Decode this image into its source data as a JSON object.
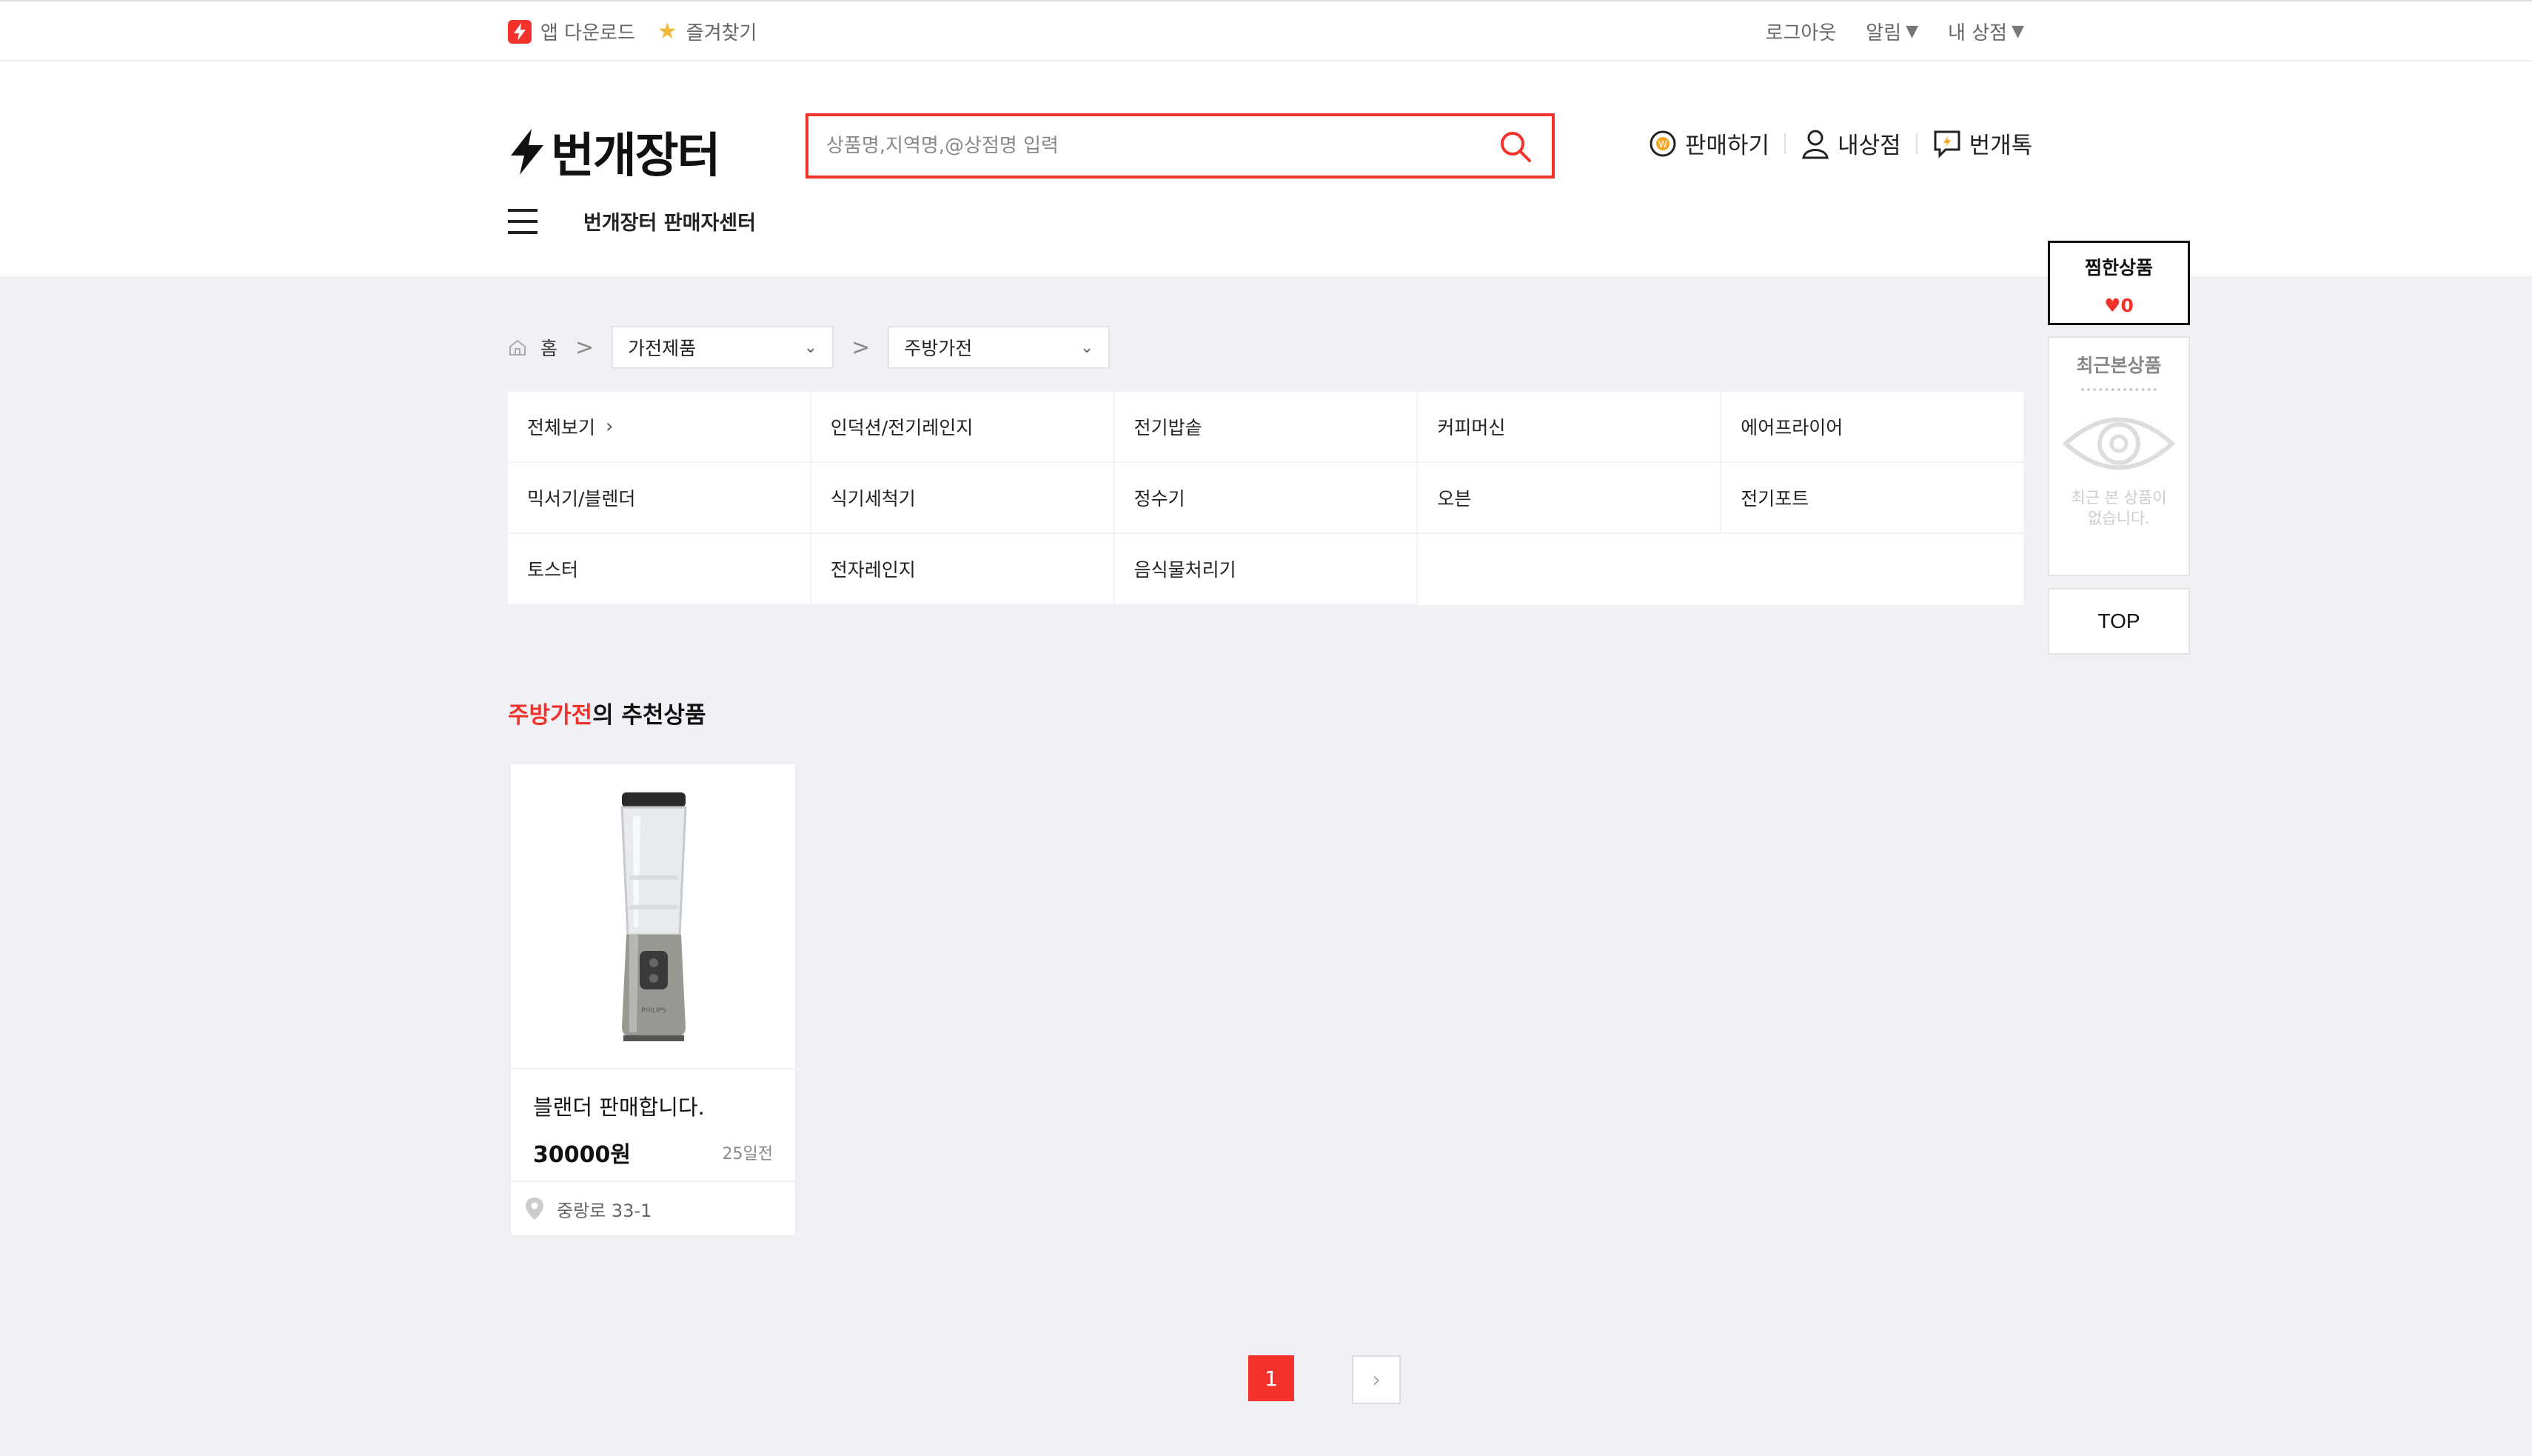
{
  "topbar": {
    "app_download": "앱 다운로드",
    "bookmark": "즐겨찾기",
    "logout": "로그아웃",
    "alerts": "알림",
    "my_store": "내 상점",
    "dropdown_glyph": "▼"
  },
  "header": {
    "logo_text": "번개장터",
    "search_placeholder": "상품명,지역명,@상점명 입력",
    "sell": "판매하기",
    "my_shop": "내상점",
    "bunjang_talk": "번개톡",
    "seller_center": "번개장터 판매자센터"
  },
  "breadcrumb": {
    "home": "홈",
    "arrow": ">",
    "category1": "가전제품",
    "category2": "주방가전"
  },
  "categories": [
    "전체보기",
    "인덕션/전기레인지",
    "전기밥솥",
    "커피머신",
    "에어프라이어",
    "믹서기/블렌더",
    "식기세척기",
    "정수기",
    "오븐",
    "전기포트",
    "토스터",
    "전자레인지",
    "음식물처리기"
  ],
  "recommend": {
    "highlight": "주방가전",
    "rest": "의 추천상품"
  },
  "product": {
    "name": "블랜더 판매합니다.",
    "price": "30000원",
    "time": "25일전",
    "location": "중랑로 33-1",
    "brand_mark": "PHILIPS"
  },
  "pagination": {
    "current": "1",
    "next": "›"
  },
  "sidebar": {
    "wish_title": "찜한상품",
    "wish_count": "♥0",
    "recent_title": "최근본상품",
    "recent_empty_line1": "최근 본 상품이",
    "recent_empty_line2": "없습니다.",
    "top": "TOP"
  },
  "colors": {
    "accent": "#f2322b",
    "background": "#f1f1f5"
  }
}
